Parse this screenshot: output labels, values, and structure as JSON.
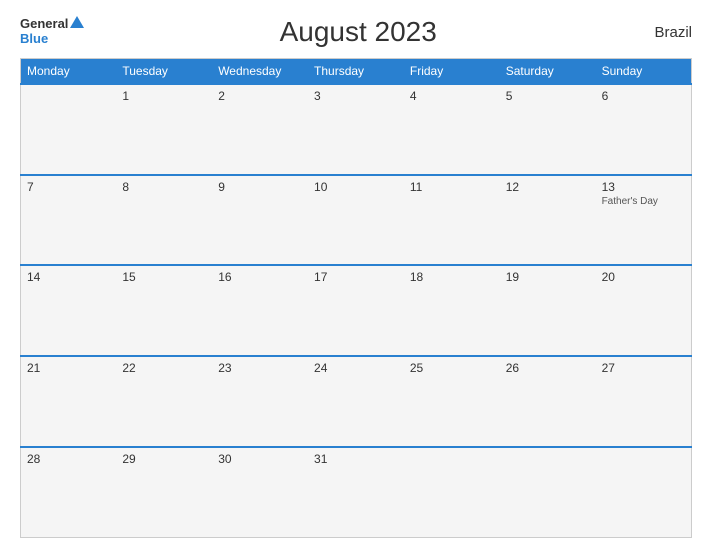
{
  "header": {
    "title": "August 2023",
    "country": "Brazil",
    "logo_general": "General",
    "logo_blue": "Blue"
  },
  "weekdays": [
    "Monday",
    "Tuesday",
    "Wednesday",
    "Thursday",
    "Friday",
    "Saturday",
    "Sunday"
  ],
  "weeks": [
    [
      {
        "num": "",
        "event": ""
      },
      {
        "num": "1",
        "event": ""
      },
      {
        "num": "2",
        "event": ""
      },
      {
        "num": "3",
        "event": ""
      },
      {
        "num": "4",
        "event": ""
      },
      {
        "num": "5",
        "event": ""
      },
      {
        "num": "6",
        "event": ""
      }
    ],
    [
      {
        "num": "7",
        "event": ""
      },
      {
        "num": "8",
        "event": ""
      },
      {
        "num": "9",
        "event": ""
      },
      {
        "num": "10",
        "event": ""
      },
      {
        "num": "11",
        "event": ""
      },
      {
        "num": "12",
        "event": ""
      },
      {
        "num": "13",
        "event": "Father's Day"
      }
    ],
    [
      {
        "num": "14",
        "event": ""
      },
      {
        "num": "15",
        "event": ""
      },
      {
        "num": "16",
        "event": ""
      },
      {
        "num": "17",
        "event": ""
      },
      {
        "num": "18",
        "event": ""
      },
      {
        "num": "19",
        "event": ""
      },
      {
        "num": "20",
        "event": ""
      }
    ],
    [
      {
        "num": "21",
        "event": ""
      },
      {
        "num": "22",
        "event": ""
      },
      {
        "num": "23",
        "event": ""
      },
      {
        "num": "24",
        "event": ""
      },
      {
        "num": "25",
        "event": ""
      },
      {
        "num": "26",
        "event": ""
      },
      {
        "num": "27",
        "event": ""
      }
    ],
    [
      {
        "num": "28",
        "event": ""
      },
      {
        "num": "29",
        "event": ""
      },
      {
        "num": "30",
        "event": ""
      },
      {
        "num": "31",
        "event": ""
      },
      {
        "num": "",
        "event": ""
      },
      {
        "num": "",
        "event": ""
      },
      {
        "num": "",
        "event": ""
      }
    ]
  ]
}
